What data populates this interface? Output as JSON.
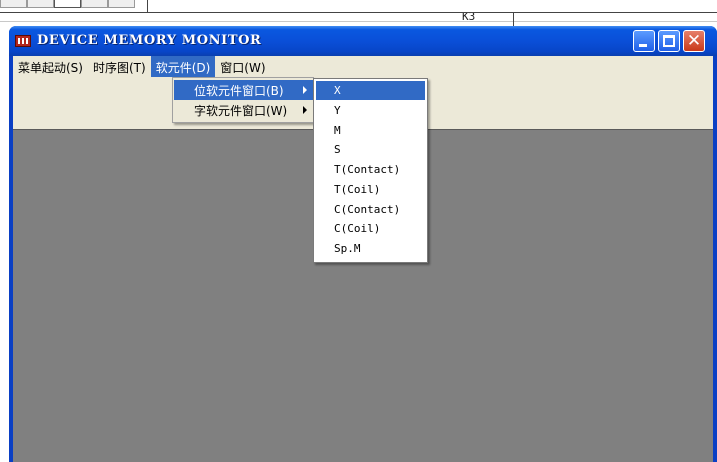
{
  "background_app": {
    "cell_labels": [
      "",
      "",
      "",
      "",
      "",
      ""
    ],
    "label": "K3"
  },
  "window": {
    "title": "DEVICE MEMORY MONITOR",
    "icon": "app-icon",
    "controls": {
      "minimize": "minimize-icon",
      "maximize": "maximize-icon",
      "close": "close-icon"
    }
  },
  "menubar": {
    "items": [
      {
        "label": "菜单起动(S)"
      },
      {
        "label": "时序图(T)"
      },
      {
        "label": "软元件(D)"
      },
      {
        "label": "窗口(W)"
      }
    ],
    "active_index": 2
  },
  "device_menu": {
    "items": [
      {
        "label": "位软元件窗口(B)"
      },
      {
        "label": "字软元件窗口(W)"
      }
    ],
    "highlighted_index": 0
  },
  "bit_device_submenu": {
    "items": [
      "X",
      "Y",
      "M",
      "S",
      "T(Contact)",
      "T(Coil)",
      "C(Contact)",
      "C(Coil)",
      "Sp.M"
    ],
    "highlighted_index": 0
  },
  "colors": {
    "titlebar": "#0a4fd8",
    "highlight": "#316ac5",
    "client": "#ece9d8",
    "workspace": "#808080"
  }
}
